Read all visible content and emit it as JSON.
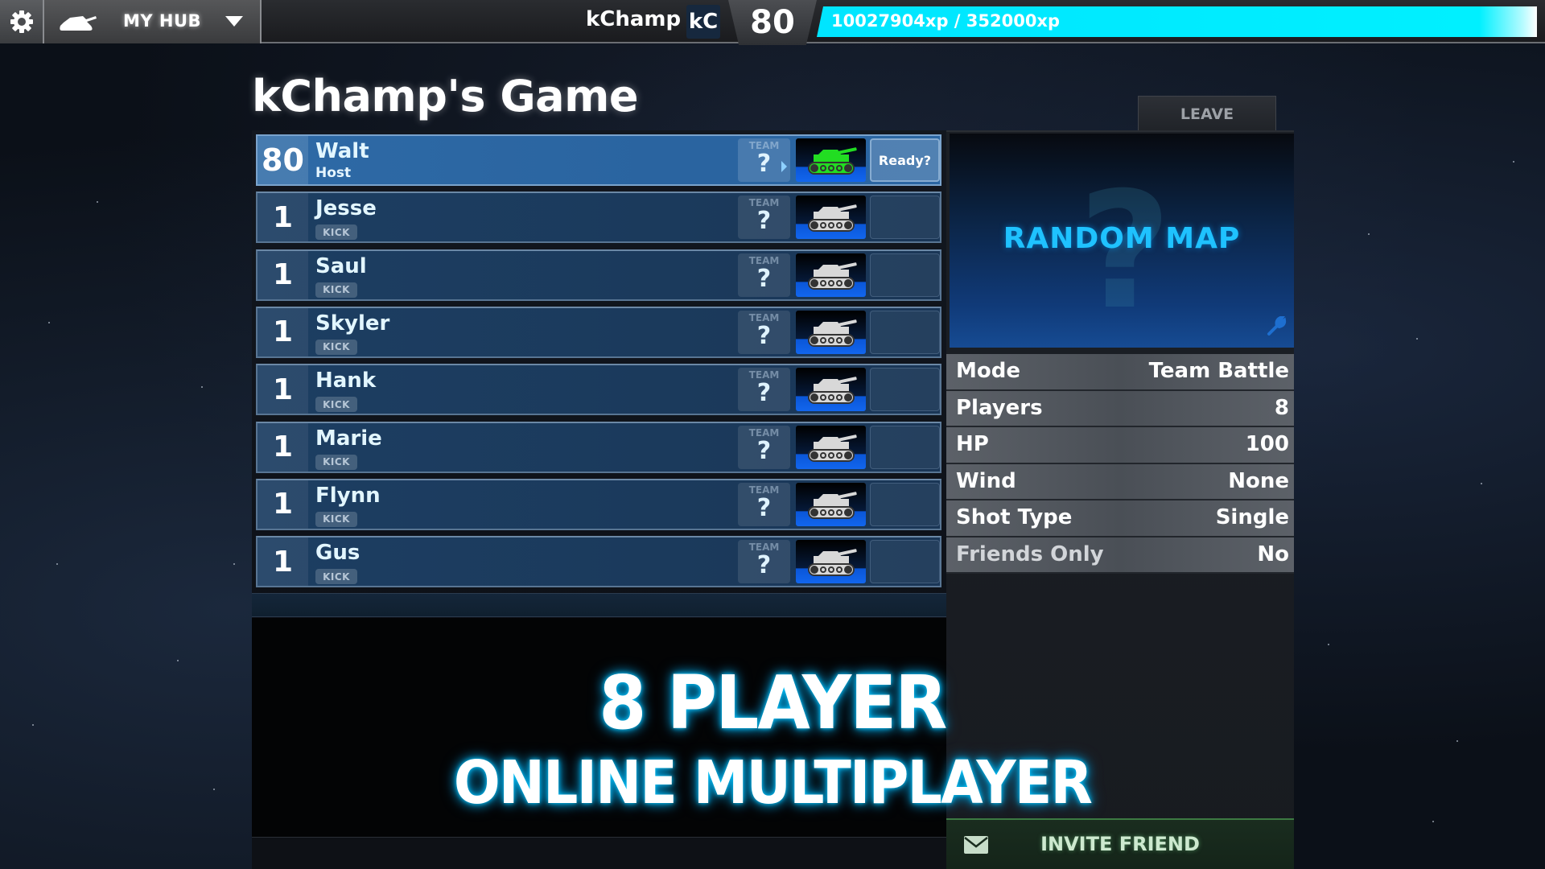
{
  "topbar": {
    "hub_label": "MY HUB",
    "username": "kChamp",
    "badge": "kC",
    "level": "80",
    "xp_text": "10027904xp / 352000xp",
    "xp_fill_fraction": 1.0,
    "xp_color": "#00f0ff"
  },
  "lobby": {
    "title": "kChamp's Game",
    "leave_label": "LEAVE",
    "team_label": "TEAM",
    "team_value": "?",
    "kick_label": "KICK",
    "host_sub": "Host",
    "ready_label": "Ready?",
    "players": [
      {
        "rank": "80",
        "name": "Walt",
        "role": "host",
        "tank_color": "#22dd22"
      },
      {
        "rank": "1",
        "name": "Jesse",
        "role": "guest",
        "tank_color": "#d8d8d8"
      },
      {
        "rank": "1",
        "name": "Saul",
        "role": "guest",
        "tank_color": "#d8d8d8"
      },
      {
        "rank": "1",
        "name": "Skyler",
        "role": "guest",
        "tank_color": "#d8d8d8"
      },
      {
        "rank": "1",
        "name": "Hank",
        "role": "guest",
        "tank_color": "#d8d8d8"
      },
      {
        "rank": "1",
        "name": "Marie",
        "role": "guest",
        "tank_color": "#d8d8d8"
      },
      {
        "rank": "1",
        "name": "Flynn",
        "role": "guest",
        "tank_color": "#d8d8d8"
      },
      {
        "rank": "1",
        "name": "Gus",
        "role": "guest",
        "tank_color": "#d8d8d8"
      }
    ]
  },
  "map": {
    "title": "RANDOM MAP",
    "placeholder_glyph": "?"
  },
  "settings": [
    {
      "label": "Mode",
      "value": "Team Battle"
    },
    {
      "label": "Players",
      "value": "8"
    },
    {
      "label": "HP",
      "value": "100"
    },
    {
      "label": "Wind",
      "value": "None"
    },
    {
      "label": "Shot Type",
      "value": "Single"
    },
    {
      "label": "Friends Only",
      "value": "No"
    }
  ],
  "invite": {
    "label": "INVITE FRIEND"
  },
  "promo": {
    "line1": "8 PLAYER",
    "line2": "ONLINE MULTIPLAYER",
    "glow_color": "#00c8ff"
  }
}
